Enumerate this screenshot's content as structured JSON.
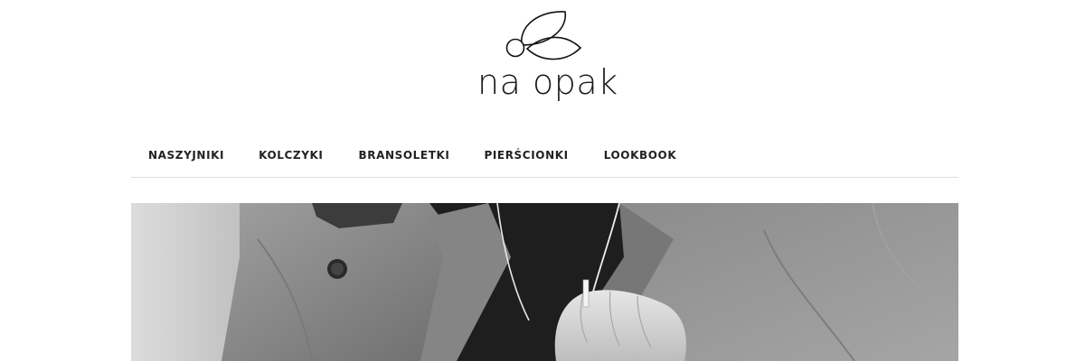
{
  "logo": {
    "text": "na opak",
    "icon": "leaf-berry-icon"
  },
  "nav": {
    "items": [
      {
        "label": "NASZYJNIKI"
      },
      {
        "label": "KOLCZYKI"
      },
      {
        "label": "BRANSOLETKI"
      },
      {
        "label": "PIERŚCIONKI"
      },
      {
        "label": "LOOKBOOK"
      }
    ]
  },
  "hero": {
    "image": "black-and-white-photo-person-with-necklace"
  },
  "colors": {
    "text": "#1a1a1a",
    "divider": "#dedede",
    "background": "#ffffff"
  }
}
